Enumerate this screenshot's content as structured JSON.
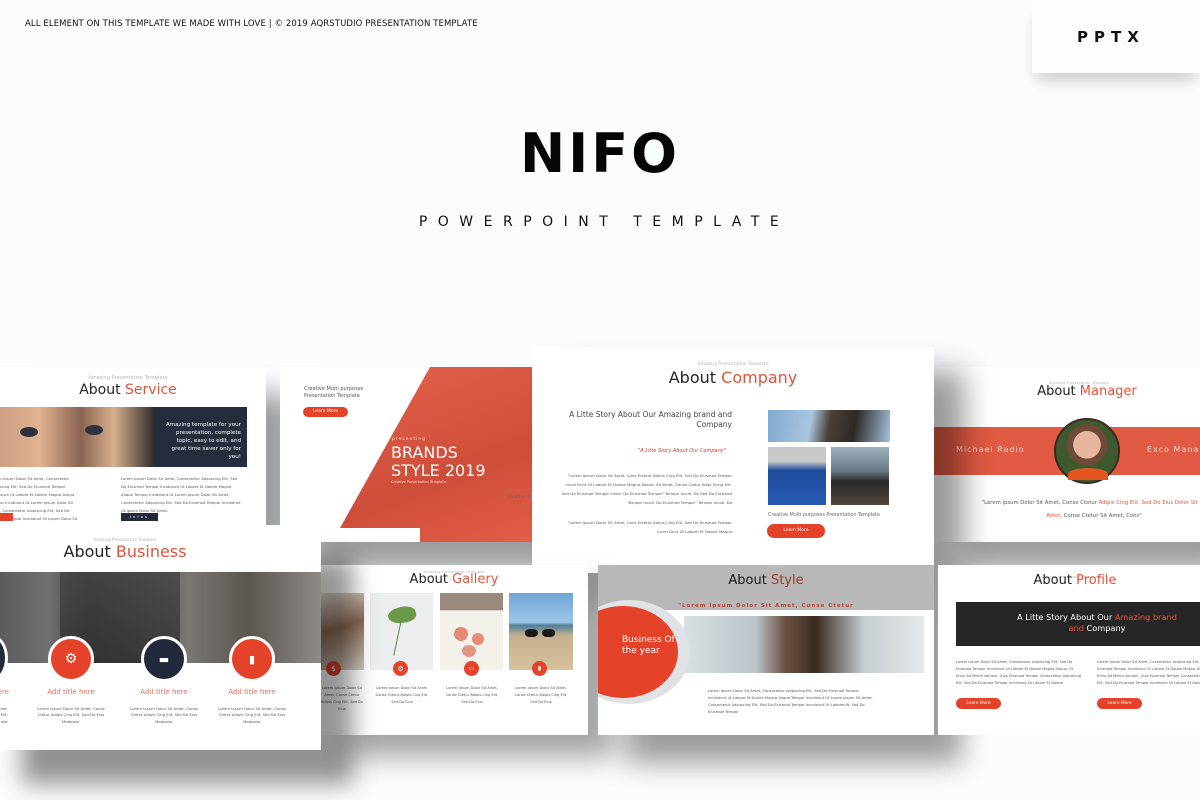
{
  "header": {
    "note": "ALL ELEMENT ON THIS TEMPLATE WE MADE WITH LOVE | © 2019 AQRSTUDIO PRESENTATION TEMPLATE",
    "format_badge": "PPTX",
    "title": "NIFO",
    "subtitle": "POWERPOINT TEMPLATE"
  },
  "colors": {
    "accent": "#e5422a",
    "dark": "#22293a",
    "background": "#fbfcfe"
  },
  "kicker": "Amazing Presentation Template",
  "slides": {
    "service": {
      "title_prefix": "About",
      "title_accent": "Service",
      "callout": "Amazing template for your presentation, complete topic, easy to edit, and great time saver only for you!",
      "para_left": "Lorem Ipsum Dolor Sit Amet, Consectetur Adipiscing Elit, Sed Do Eiusmod Tempor Incididunt Ut Labore Et Dolore Magna Aliqua Tempor Incididunt Ut Lorem Ipsum Dolor Sit Amet, Consectetur Adipiscing Elit, Sed Do Eiusmod Tempor Incididunt Ut Ipsum Dolor Sit Amet.",
      "para_right": "Lorem Ipsum Dolor Sit Amet, Consectetur Adipiscing Elit, Sed Do Eiusmod Tempor Incididunt Ut Labore Et Dolore Magna Aliqua Tempor Incididunt Ut Lorem Ipsum Dolor Sit Amet, Consectetur Adipiscing Elit, Sed Do Eiusmod Tempor Incididunt Ut Ipsum Dolor Sit Amet.",
      "button_dark": "infos"
    },
    "brands": {
      "tagline": "Creative Multi purposes Presentation Template",
      "button": "Learn More",
      "presenting": "presenting",
      "headline_1": "BRANDS",
      "headline_2": "STYLE 2019",
      "caption": "Creative Presentation Template",
      "side_text": "Creative M"
    },
    "company": {
      "title_prefix": "About",
      "title_accent": "Company",
      "story": "A Litte Story About Our Amazing brand and Company",
      "quote": "\"A Litte Story About Our Company\"",
      "para_1": "\"Lorem Ipsum Dolor Sit Amet, Cons Ectetur Adipis Cing Elit, Sed Do Eiusmod Tempor Incidi Dunt Ut Labore Et Dolore Magna Aliqua. Sit Amet, Conse Ctetur Adipi Scing Elit. Sed Do Eiusmod Tempor Incidi. Do Eiusmod Tempor\" Tempor Incidi. Do Sed Do Eiusmod Tempor Incidi. Do Eiusmod Tempor\" Tempor Incidi. Do",
      "para_2": "\"Lorem Ipsum Dolor Sit Amet, Cons Ectetur Adipis Cing Elit, Sed Do Eiusmod Tempor Incidi Dunt Ut Labore Et Dolore Magna",
      "caption": "Creative Multi purposes Presentation Template",
      "button": "Learn More"
    },
    "manager": {
      "title_prefix": "About",
      "title_accent": "Manager",
      "name": "Michael Radio",
      "role": "Exco Mana",
      "quote_plain_1": "\"Lorem Ipsum Dolor Sit Amet, Conse Ctetur ",
      "quote_accent_1": "Adipis Cing Elit, Sed Do Eius",
      "quote_accent_2": "Dolor Sit Sit Amet",
      "quote_plain_2": ", Conse Ctetur Sit Amet, Cons\""
    },
    "business": {
      "title_prefix": "About",
      "title_accent": "Business",
      "items": [
        {
          "icon": "partial-item",
          "title": "here",
          "text": "Amet, Cing Elit, olor"
        },
        {
          "icon": "gears-icon",
          "title": "Add title here",
          "text": "Lorem Ipsum Dolor Sit Amet, Conse Ctetur Adipis Cing Elit, Sed Do Eius Moddolor"
        },
        {
          "icon": "folder-icon",
          "title": "Add title here",
          "text": "Lorem Ipsum Dolor Sit Amet, Conse Ctetur Adipis Cing Elit, Sed Do Eius Moddolor"
        },
        {
          "icon": "bar-chart-icon",
          "title": "Add title here",
          "text": "Lorem Ipsum Dolor Sit Amet, Conse Ctetur Adipis Cing Elit, Sed Do Eius Moddolor"
        }
      ]
    },
    "gallery": {
      "title_prefix": "About",
      "title_accent": "Gallery",
      "items": [
        {
          "icon": "money-bag-icon",
          "text": "Lorem Ipsum Dolor Sit Amet, Conse Ctetur Adipis Cing Elit, Sed Do Eius"
        },
        {
          "icon": "gears-icon",
          "text": "Lorem Ipsum Dolor Sit Amet, Conse Ctetur Adipis Cing Elit, Sed Do Eius"
        },
        {
          "icon": "folder-icon",
          "text": "Lorem Ipsum Dolor Sit Amet, Conse Ctetur Adipis Cing Elit, Sed Do Eius"
        },
        {
          "icon": "bar-chart-icon",
          "text": "Lorem Ipsum Dolor Sit Amet, Conse Ctetur Adipis Cing Elit, Sed Do Eius"
        }
      ]
    },
    "style": {
      "title_prefix": "About",
      "title_accent": "Style",
      "tagline": "\"Lorem Ipsum Dolor Sit Amet, Conse Ctetur",
      "badge": "Business Of the year",
      "para": "Lorem Ipsum Dolor Sit Amet, Consectetur Adipiscing Elit, Sed Do Eiusmod Tempor Incididunt Ut Labore Et Dolore Magna Aliqua Tempor Incididunt Ut Lorem Ipsum Sit Amet, Consectetur Adipiscing Elit, Sed Do Eiusmod Tempor Incididunt Ut Laborenlit, Sed Do Eiusmod Tempor"
    },
    "profile": {
      "title_prefix": "About",
      "title_accent": "Profile",
      "banner_plain_1": "A Litte Story About Our ",
      "banner_accent_1": "Amazing brand",
      "banner_accent_2": "and",
      "banner_plain_2": " Company",
      "para_left": "Lorem Ipsum Dolor Sit Amet, Consectetur Adipiscing Elit, Sed Do Eiusmod Tempor Incididunt Ut Labore Et Dolore Magna Aliqua. Ut Enim Ad Minim Veniam, Quis Eiusmod Tempor Consectetur Adipiscing Elit, Sed Do Eiusmod Tempor Incididunt Ut Labore Et Dolore",
      "para_right": "Lorem Ipsum Dolor Sit Amet, Consectetur Adipiscing Elit, Sed Do Eiusmod Tempor Incididunt Ut Labore Et Dolore Magna Aliqua. Ut Enim Ad Minim Veniam, Quis Eiusmod Tempor Consectetur Adipiscing Elit, Sed Do Eiusmod Tempor Incididunt Ut Labore Et Dolore",
      "button": "Learn More"
    }
  }
}
